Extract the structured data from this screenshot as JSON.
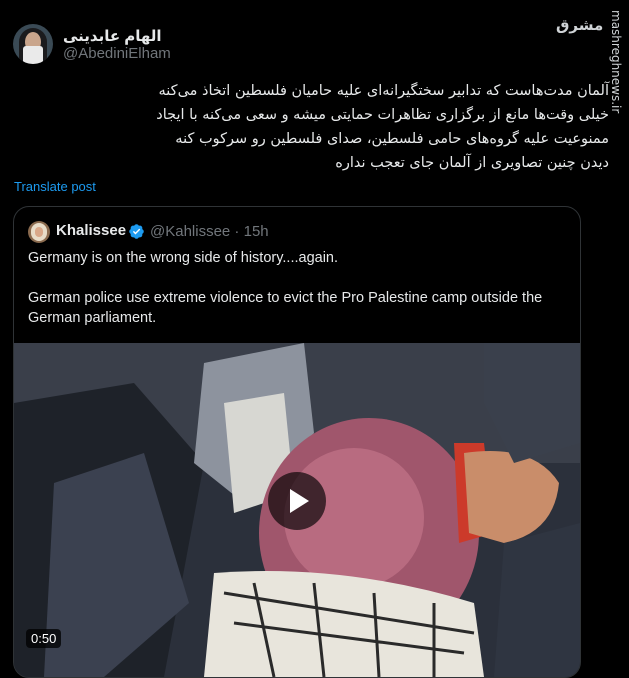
{
  "author": {
    "display_name": "الهام عابدینی",
    "handle": "@AbediniElham"
  },
  "post": {
    "text_lines": [
      "آلمان مدت‌هاست که تدابیر سختگیرانه‌ای علیه حامیان فلسطین اتخاذ می‌کنه",
      "خیلی وقت‌ها مانع از برگزاری تظاهرات حمایتی میشه و سعی می‌کنه با ایجاد",
      "ممنوعیت علیه گروه‌های حامی فلسطین، صدای فلسطین رو سرکوب کنه",
      "دیدن چنین تصاویری از آلمان جای تعجب نداره"
    ],
    "translate_label": "Translate post"
  },
  "quoted": {
    "display_name": "Khalissee",
    "verified_icon": "verified-badge-icon",
    "handle_time": "@Kahlissee · 15h",
    "paragraphs": [
      "Germany is on the wrong side of history....again.",
      "German police use extreme violence to evict the Pro Palestine camp outside the German parliament."
    ],
    "video": {
      "duration": "0:50",
      "play_icon": "play-icon"
    }
  },
  "watermark": {
    "site": "mashreghnews.ir",
    "logo": "مشرق"
  },
  "colors": {
    "background": "#000000",
    "text": "#e7e9ea",
    "secondary": "#71767b",
    "link": "#1d9bf0",
    "verified": "#1d9bf0",
    "border": "#2f3336"
  }
}
